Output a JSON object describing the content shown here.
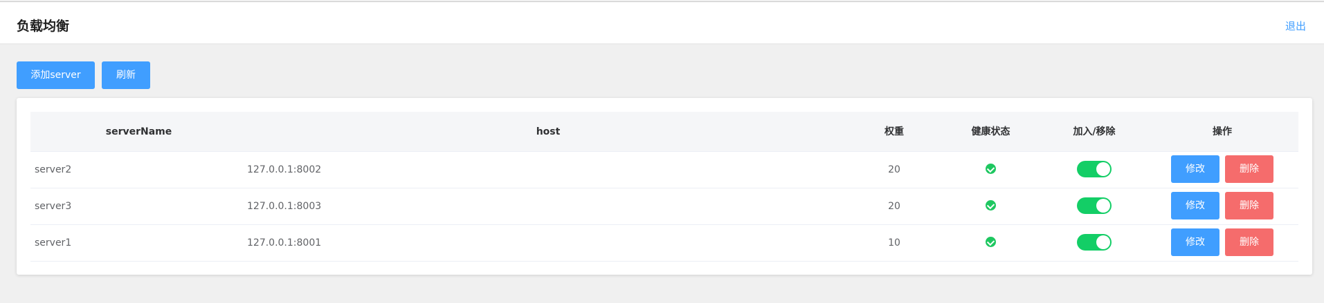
{
  "header": {
    "title": "负载均衡",
    "logout": "退出"
  },
  "toolbar": {
    "add_label": "添加server",
    "refresh_label": "刷新"
  },
  "table": {
    "columns": [
      "serverName",
      "host",
      "权重",
      "健康状态",
      "加入/移除",
      "操作"
    ],
    "rows": [
      {
        "name": "server2",
        "host": "127.0.0.1:8002",
        "weight": "20",
        "healthy": true,
        "enabled": true
      },
      {
        "name": "server3",
        "host": "127.0.0.1:8003",
        "weight": "20",
        "healthy": true,
        "enabled": true
      },
      {
        "name": "server1",
        "host": "127.0.0.1:8001",
        "weight": "10",
        "healthy": true,
        "enabled": true
      }
    ],
    "actions": {
      "edit": "修改",
      "delete": "删除"
    }
  },
  "colors": {
    "primary": "#409eff",
    "danger": "#f56c6c",
    "success": "#13ce66"
  },
  "icons": {
    "health": "check-circle-icon"
  }
}
